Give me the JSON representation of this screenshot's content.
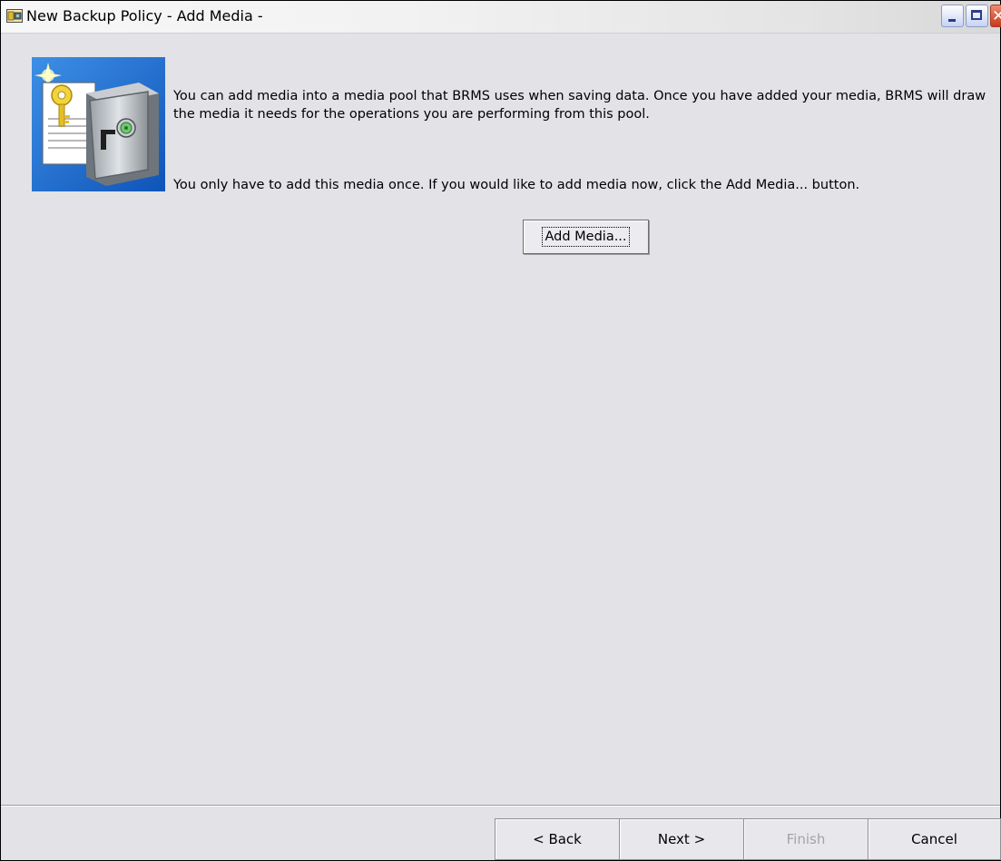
{
  "window": {
    "title": "New Backup Policy - Add Media -",
    "minimize_icon": "minimize-icon",
    "maximize_icon": "maximize-icon",
    "close_icon": "close-icon"
  },
  "content": {
    "image_icon": "safe-with-key-icon",
    "message_1": "You can add media into a media pool that BRMS uses when saving data. Once you have added your media, BRMS will draw the media it needs for the operations you are performing from this pool.",
    "message_2": "You only have to add this media once. If you would like to add media now, click the Add Media... button.",
    "add_media_label": "Add Media..."
  },
  "footer": {
    "back_label": "< Back",
    "next_label": "Next >",
    "finish_label": "Finish",
    "finish_enabled": false,
    "cancel_label": "Cancel"
  },
  "colors": {
    "dialog_background": "#e3e2e7",
    "close_button": "#c7391c",
    "disabled_text": "#a3a3a8",
    "image_background": "#1e73d2"
  }
}
